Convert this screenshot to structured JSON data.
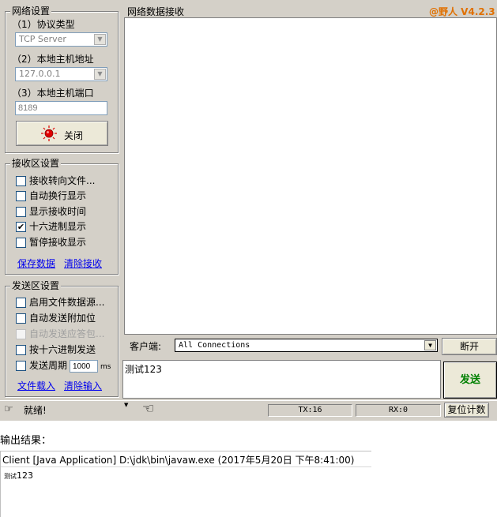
{
  "network": {
    "title": "网络设置",
    "protocol_label": "（1）协议类型",
    "protocol_value": "TCP Server",
    "host_label": "（2）本地主机地址",
    "host_value": "127.0.0.1",
    "port_label": "（3）本地主机端口",
    "port_value": "8189",
    "toggle_label": "关闭"
  },
  "receive": {
    "title": "接收区设置",
    "options": [
      {
        "label": "接收转向文件...",
        "checked": false,
        "disabled": false
      },
      {
        "label": "自动换行显示",
        "checked": false,
        "disabled": false
      },
      {
        "label": "显示接收时间",
        "checked": false,
        "disabled": false
      },
      {
        "label": "十六进制显示",
        "checked": true,
        "disabled": false
      },
      {
        "label": "暂停接收显示",
        "checked": false,
        "disabled": false
      }
    ],
    "save_link": "保存数据",
    "clear_link": "清除接收"
  },
  "send": {
    "title": "发送区设置",
    "options": [
      {
        "label": "启用文件数据源...",
        "checked": false,
        "disabled": false
      },
      {
        "label": "自动发送附加位",
        "checked": false,
        "disabled": false
      },
      {
        "label": "自动发送应答包...",
        "checked": false,
        "disabled": true
      },
      {
        "label": "按十六进制发送",
        "checked": false,
        "disabled": false
      }
    ],
    "period_label": "发送周期",
    "period_value": "1000",
    "period_unit": "ms",
    "load_link": "文件载入",
    "clear_link": "清除输入"
  },
  "data_area": {
    "title": "网络数据接收",
    "brand": "@野人 V4.2.3"
  },
  "client": {
    "label": "客户端:",
    "value": "All Connections",
    "disconnect": "断开"
  },
  "input": {
    "text": "测试123",
    "send_button": "发送"
  },
  "status": {
    "text": "就绪!",
    "tx": "TX:16",
    "rx": "RX:0",
    "reset": "复位计数"
  },
  "console": {
    "heading": "输出结果：",
    "title": "Client [Java Application] D:\\jdk\\bin\\javaw.exe (2017年5月20日 下午8:41:00)",
    "prefix": "测试",
    "suffix": "123"
  },
  "colors": {
    "brand": "#e07000",
    "send_text": "#008000",
    "led": "#e00000",
    "link": "#0000ee"
  }
}
